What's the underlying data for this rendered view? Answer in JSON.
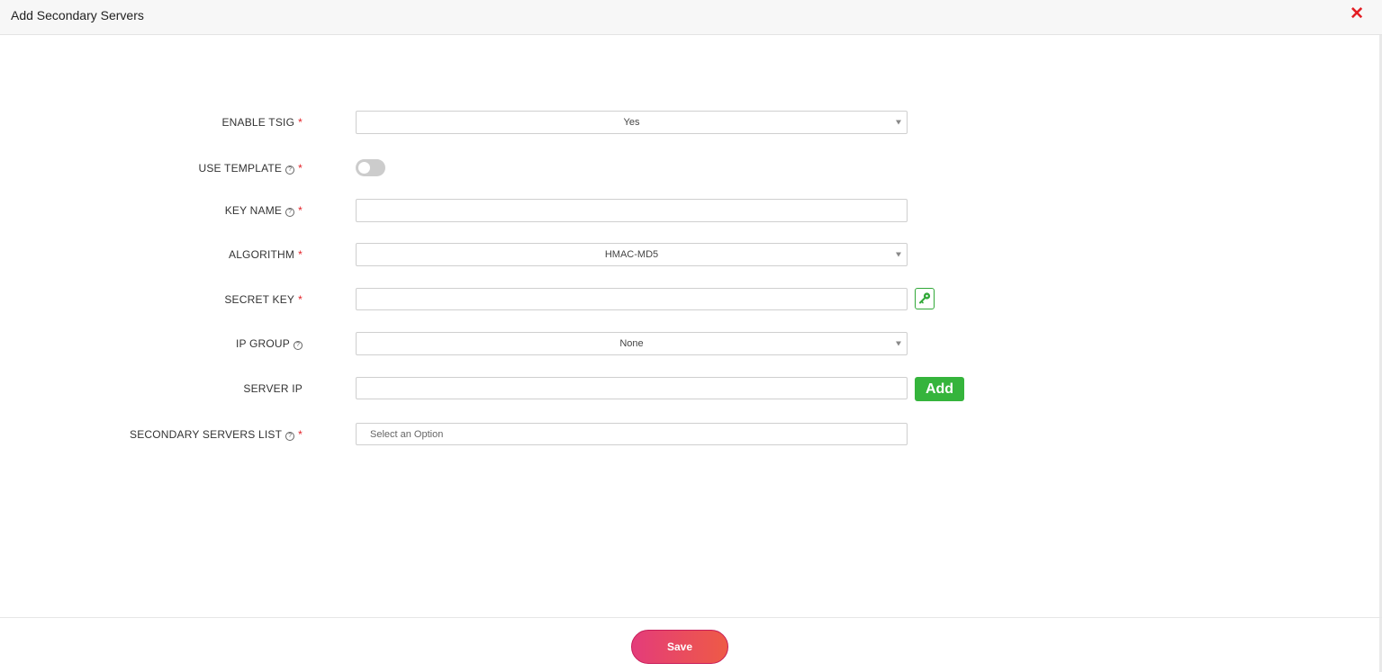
{
  "dialog": {
    "title": "Add Secondary Servers",
    "close_label": "✕"
  },
  "form": {
    "enable_tsig": {
      "label": "ENABLE TSIG",
      "required": "*",
      "value": "Yes"
    },
    "use_template": {
      "label": "USE TEMPLATE",
      "help": "?",
      "required": "*",
      "enabled": false
    },
    "key_name": {
      "label": "KEY NAME",
      "help": "?",
      "required": "*",
      "value": ""
    },
    "algorithm": {
      "label": "ALGORITHM",
      "required": "*",
      "value": "HMAC-MD5"
    },
    "secret_key": {
      "label": "SECRET KEY",
      "required": "*",
      "value": ""
    },
    "ip_group": {
      "label": "IP GROUP",
      "help": "?",
      "value": "None"
    },
    "server_ip": {
      "label": "SERVER IP",
      "value": "",
      "add_label": "Add"
    },
    "secondary_servers_list": {
      "label": "SECONDARY SERVERS LIST",
      "help": "?",
      "required": "*",
      "placeholder": "Select an Option"
    }
  },
  "footer": {
    "save_label": "Save"
  },
  "colors": {
    "required": "#e31e24",
    "add_button": "#35b43c",
    "save_gradient_start": "#e43c7a",
    "save_gradient_end": "#ee5a46"
  }
}
